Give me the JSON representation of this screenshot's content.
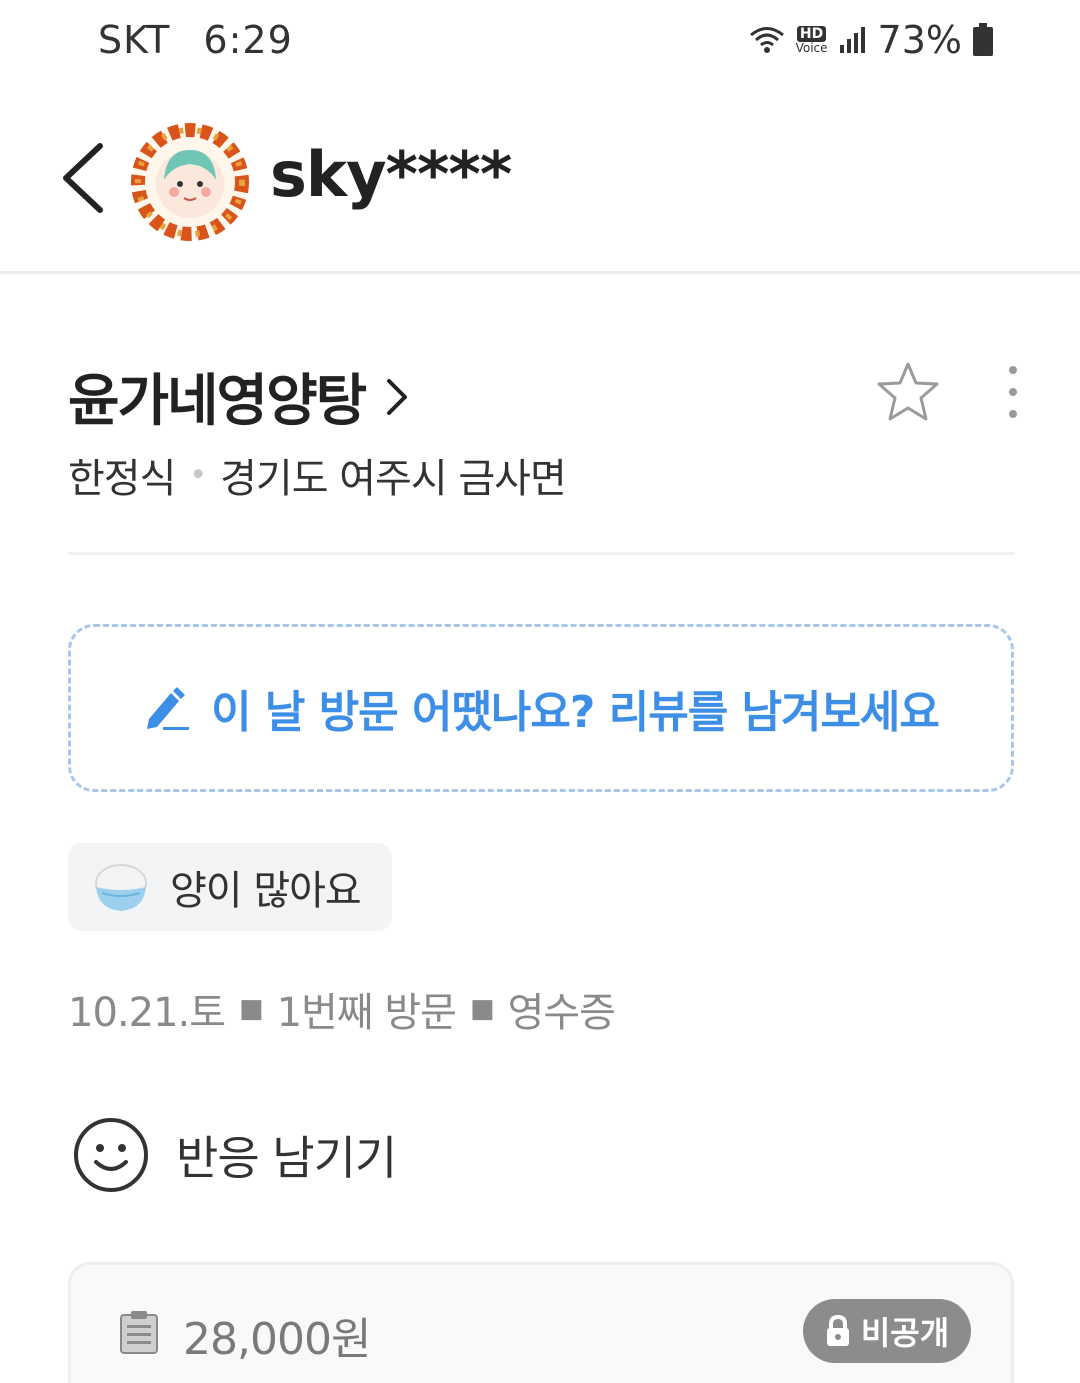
{
  "status_bar": {
    "carrier": "SKT",
    "time": "6:29",
    "hd": "HD",
    "voice": "Voice",
    "battery": "73%"
  },
  "header": {
    "user_name": "sky****"
  },
  "restaurant": {
    "name": "윤가네영양탕",
    "category": "한정식",
    "location": "경기도 여주시 금사면"
  },
  "review_prompt": {
    "text": "이 날 방문 어땠나요? 리뷰를 남겨보세요"
  },
  "tag": {
    "text": "양이 많아요"
  },
  "visit": {
    "date": "10.21.토",
    "count": "1번째 방문",
    "proof": "영수증"
  },
  "reaction": {
    "label": "반응 남기기"
  },
  "receipt": {
    "price": "28,000원",
    "visibility": "비공개"
  },
  "colors": {
    "accent_blue": "#3d8ee6",
    "dashed_border": "#a8c8ea",
    "badge_gray": "#8c8c8c"
  }
}
